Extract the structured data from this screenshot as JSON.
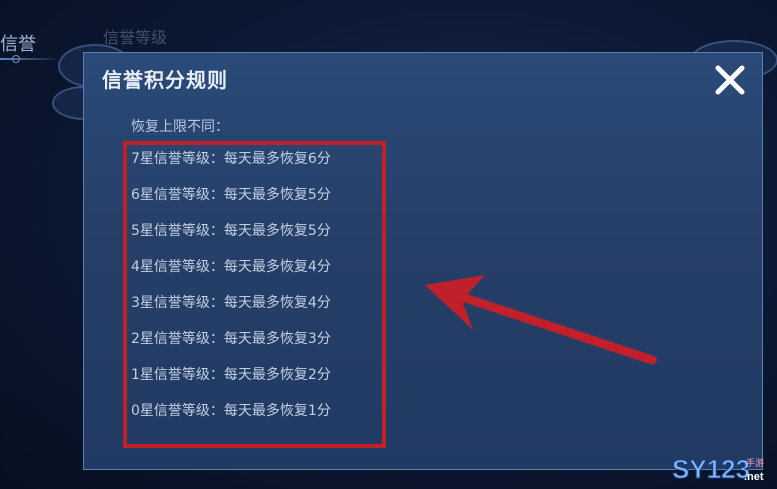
{
  "background": {
    "active_tab": "信誉",
    "second_tab": "信誉等级"
  },
  "dialog": {
    "title": "信誉积分规则",
    "subtitle": "恢复上限不同：",
    "rules": [
      "7星信誉等级：每天最多恢复6分",
      "6星信誉等级：每天最多恢复5分",
      "5星信誉等级：每天最多恢复5分",
      "4星信誉等级：每天最多恢复4分",
      "3星信誉等级：每天最多恢复4分",
      "2星信誉等级：每天最多恢复3分",
      "1星信誉等级：每天最多恢复2分",
      "0星信誉等级：每天最多恢复1分"
    ],
    "close_icon": "close-icon"
  },
  "annotation": {
    "highlight_color": "#c0202a",
    "arrow_color": "#c0202a"
  },
  "watermark": {
    "text": "SY123",
    "suffix": "手游",
    "domain": ".net"
  }
}
